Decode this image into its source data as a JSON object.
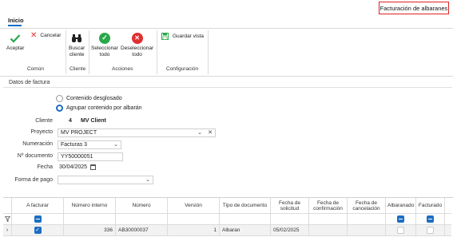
{
  "window": {
    "title": "Facturación de albaranes"
  },
  "tabs": {
    "active": "Inicio"
  },
  "ribbon": {
    "aceptar": "Aceptar",
    "cancelar": "Cancelar",
    "buscar_cliente_1": "Buscar",
    "buscar_cliente_2": "cliente",
    "seleccionar_1": "Seleccionar",
    "seleccionar_2": "todo",
    "deseleccionar_1": "Deseleccionar",
    "deseleccionar_2": "todo",
    "guardar_vista": "Guardar vista",
    "groups": {
      "comun": "Común",
      "cliente": "Cliente",
      "acciones": "Acciones",
      "configuracion": "Configuración"
    }
  },
  "form": {
    "section_title": "Datos de factura",
    "radio_desglosado": "Contenido desglosado",
    "radio_agrupar": "Agrupar contenido por albarán",
    "cliente_label": "Cliente",
    "cliente_code": "4",
    "cliente_name": "MV Client",
    "proyecto_label": "Proyecto",
    "proyecto_value": "MV PROJECT",
    "numeracion_label": "Numeración",
    "numeracion_value": "Facturas 3",
    "documento_label": "Nº documento",
    "documento_value": "YY50000051",
    "fecha_label": "Fecha",
    "fecha_value": "30/04/2025",
    "forma_pago_label": "Forma de pago",
    "forma_pago_value": ""
  },
  "grid": {
    "headers": {
      "a_facturar": "A facturar",
      "numero_interno": "Número interno",
      "numero": "Número",
      "version": "Versión",
      "tipo_documento": "Tipo de documento",
      "fecha_solicitud_1": "Fecha de",
      "fecha_solicitud_2": "solicitud",
      "fecha_confirmacion_1": "Fecha de",
      "fecha_confirmacion_2": "confirmación",
      "fecha_cancelacion_1": "Fecha de",
      "fecha_cancelacion_2": "cancelación",
      "albaranado": "Albaranado",
      "facturado": "Facturado"
    },
    "row": {
      "numero_interno": "336",
      "numero": "AB30000037",
      "version": "1",
      "tipo_documento": "Albaran",
      "fecha_solicitud": "05/02/2025"
    }
  },
  "colors": {
    "accent": "#1b6ec2",
    "highlight_border": "#e02020",
    "green": "#2aa84a",
    "red": "#e03030"
  }
}
